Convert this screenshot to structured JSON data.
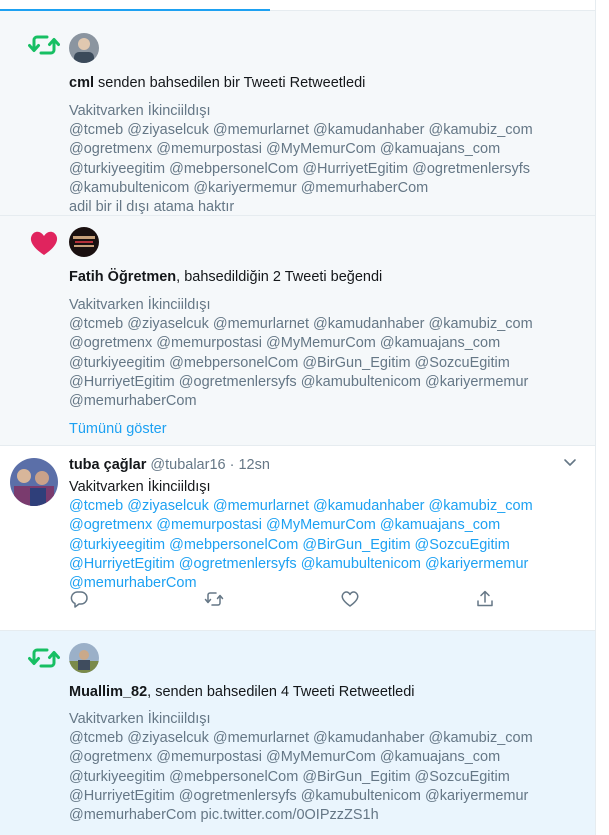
{
  "colors": {
    "retweet_green": "#17bf63",
    "like_red": "#e0245e",
    "link_blue": "#1da1f2",
    "muted_gray": "#657786"
  },
  "icons": {
    "retweet": "retweet-icon",
    "like": "heart-icon",
    "reply": "reply-icon",
    "share": "share-icon",
    "caret": "chevron-down-icon"
  },
  "notifications": [
    {
      "type": "retweet",
      "actor": "cml",
      "action_text": " senden bahsedilen bir Tweeti Retweetledi",
      "lines": [
        "Vakitvarken İkinciildışı",
        "@tcmeb @ziyaselcuk @memurlarnet @kamudanhaber @kamubiz_com",
        "@ogretmenx @memurpostasi @MyMemurCom @kamuajans_com",
        "@turkiyeegitim @mebpersonelCom @HurriyetEgitim @ogretmenlersyfs",
        "@kamubultenicom @kariyermemur @memurhaberCom",
        "adil bir il dışı atama haktır"
      ]
    },
    {
      "type": "like",
      "actor": "Fatih Öğretmen",
      "action_text": ", bahsedildiğin 2 Tweeti beğendi",
      "lines": [
        "Vakitvarken İkinciildışı",
        "@tcmeb @ziyaselcuk @memurlarnet @kamudanhaber @kamubiz_com",
        "@ogretmenx @memurpostasi @MyMemurCom @kamuajans_com",
        "@turkiyeegitim @mebpersonelCom @BirGun_Egitim @SozcuEgitim",
        "@HurriyetEgitim @ogretmenlersyfs @kamubultenicom @kariyermemur",
        "@memurhaberCom"
      ],
      "show_all": "Tümünü göster"
    },
    {
      "type": "tweet",
      "name": "tuba çağlar",
      "handle": "@tubalar16",
      "separator": "·",
      "time": "12sn",
      "first_line": "Vakitvarken İkinciildışı",
      "link_lines": [
        "@tcmeb @ziyaselcuk @memurlarnet @kamudanhaber @kamubiz_com",
        "@ogretmenx @memurpostasi @MyMemurCom @kamuajans_com",
        "@turkiyeegitim @mebpersonelCom @BirGun_Egitim @SozcuEgitim",
        "@HurriyetEgitim @ogretmenlersyfs @kamubultenicom @kariyermemur",
        "@memurhaberCom"
      ]
    },
    {
      "type": "retweet",
      "actor": "Muallim_82",
      "action_text": ", senden bahsedilen 4 Tweeti Retweetledi",
      "lines": [
        "Vakitvarken İkinciildışı",
        "@tcmeb @ziyaselcuk @memurlarnet @kamudanhaber @kamubiz_com",
        "@ogretmenx @memurpostasi @MyMemurCom @kamuajans_com",
        "@turkiyeegitim @mebpersonelCom @BirGun_Egitim @SozcuEgitim",
        "@HurriyetEgitim @ogretmenlersyfs @kamubultenicom @kariyermemur",
        "@memurhaberCom pic.twitter.com/0OIPzzZS1h"
      ]
    }
  ]
}
